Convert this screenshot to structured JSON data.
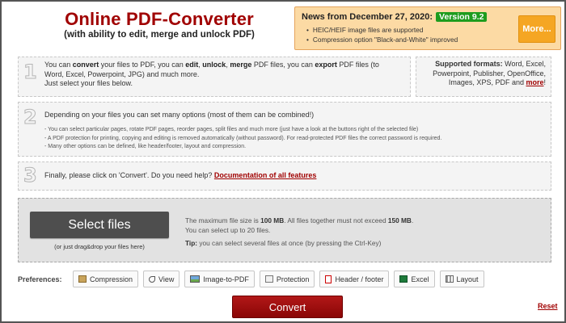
{
  "header": {
    "title": "Online PDF-Converter",
    "subtitle": "(with ability to edit, merge and unlock PDF)"
  },
  "news": {
    "heading": "News from December 27, 2020:",
    "version_badge": "Version 9.2",
    "items": [
      "HEIC/HEIF image files are supported",
      "Compression option \"Black-and-White\" improved"
    ],
    "more_label": "More..."
  },
  "steps": {
    "step1": {
      "number": "1",
      "t1": "You can ",
      "b1": "convert",
      "t2": " your files to PDF, you can ",
      "b2": "edit",
      "t3": ", ",
      "b3": "unlock",
      "t4": ", ",
      "b4": "merge",
      "t5": " PDF files, you can ",
      "b5": "export",
      "t6": " PDF files (to",
      "line2": "Word, Excel, Powerpoint, JPG) and much more.",
      "line3": "Just select your files below."
    },
    "formats": {
      "label": "Supported formats:",
      "line1_rest": " Word, Excel,",
      "line2": "Powerpoint, Publisher, OpenOffice,",
      "line3_pre": "Images, XPS, PDF and ",
      "more_link": "more",
      "line3_post": "!"
    },
    "step2": {
      "number": "2",
      "heading": "Depending on your files you can set many options (most of them can be combined!)",
      "notes": [
        "- You can select particular pages, rotate PDF pages, reorder pages, split files and much more (just have a look at the buttons right of the selected file)",
        "- A PDF protection for printing, copying and editing is removed automatically (without password). For read-protected PDF files the correct password is required.",
        "- Many other options can be defined, like header/footer, layout and compression."
      ]
    },
    "step3": {
      "number": "3",
      "text": "Finally, please click on 'Convert'. Do you need help? ",
      "link": "Documentation of all features"
    }
  },
  "upload": {
    "select_label": "Select files",
    "drag_hint": "(or just drag&drop your files here)",
    "info_a": "The maximum file size is ",
    "info_b": "100 MB",
    "info_c": ". All files together must not exceed ",
    "info_d": "150 MB",
    "info_e": ".",
    "info_line2": "You can select up to 20 files.",
    "tip_label": "Tip:",
    "tip_text": " you can select several files at once (by pressing the Ctrl-Key)"
  },
  "preferences": {
    "label": "Preferences:",
    "buttons": [
      {
        "label": "Compression",
        "icon": "compression-icon"
      },
      {
        "label": "View",
        "icon": "view-icon"
      },
      {
        "label": "Image-to-PDF",
        "icon": "image-icon"
      },
      {
        "label": "Protection",
        "icon": "protection-icon"
      },
      {
        "label": "Header / footer",
        "icon": "header-footer-icon"
      },
      {
        "label": "Excel",
        "icon": "excel-icon"
      },
      {
        "label": "Layout",
        "icon": "layout-icon"
      }
    ]
  },
  "actions": {
    "convert_label": "Convert",
    "reset_label": "Reset"
  },
  "colors": {
    "brand_red": "#a00000",
    "news_bg": "#fcdaa4",
    "version_green": "#1e9c1e",
    "more_orange": "#f5a623"
  }
}
